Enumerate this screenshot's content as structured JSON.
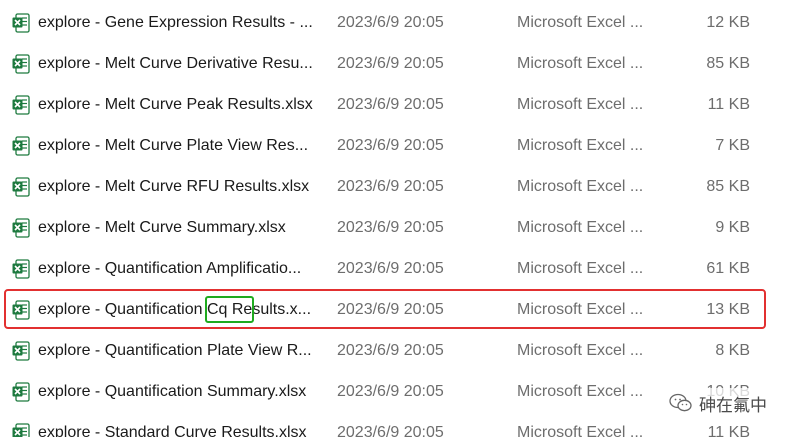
{
  "files": [
    {
      "name": "explore -  Gene Expression Results - ...",
      "date": "2023/6/9 20:05",
      "type": "Microsoft Excel ...",
      "size": "12 KB"
    },
    {
      "name": "explore -  Melt Curve Derivative Resu...",
      "date": "2023/6/9 20:05",
      "type": "Microsoft Excel ...",
      "size": "85 KB"
    },
    {
      "name": "explore -  Melt Curve Peak Results.xlsx",
      "date": "2023/6/9 20:05",
      "type": "Microsoft Excel ...",
      "size": "11 KB"
    },
    {
      "name": "explore -  Melt Curve Plate View Res...",
      "date": "2023/6/9 20:05",
      "type": "Microsoft Excel ...",
      "size": "7 KB"
    },
    {
      "name": "explore -  Melt Curve RFU Results.xlsx",
      "date": "2023/6/9 20:05",
      "type": "Microsoft Excel ...",
      "size": "85 KB"
    },
    {
      "name": "explore -  Melt Curve Summary.xlsx",
      "date": "2023/6/9 20:05",
      "type": "Microsoft Excel ...",
      "size": "9 KB"
    },
    {
      "name": "explore -  Quantification Amplificatio...",
      "date": "2023/6/9 20:05",
      "type": "Microsoft Excel ...",
      "size": "61 KB"
    },
    {
      "name": "explore -  Quantification Cq Results.x...",
      "date": "2023/6/9 20:05",
      "type": "Microsoft Excel ...",
      "size": "13 KB"
    },
    {
      "name": "explore -  Quantification Plate View R...",
      "date": "2023/6/9 20:05",
      "type": "Microsoft Excel ...",
      "size": "8 KB"
    },
    {
      "name": "explore -  Quantification Summary.xlsx",
      "date": "2023/6/9 20:05",
      "type": "Microsoft Excel ...",
      "size": "10 KB"
    },
    {
      "name": "explore -  Standard Curve Results.xlsx",
      "date": "2023/6/9 20:05",
      "type": "Microsoft Excel ...",
      "size": "11 KB"
    }
  ],
  "icons": {
    "file": "excel-file-icon",
    "watermark": "wechat-icon"
  },
  "colors": {
    "excel_green": "#1d7a3f",
    "highlight_row": "#e23030",
    "highlight_term": "#1faa1f"
  },
  "watermark": {
    "text": "砷在氟中"
  }
}
